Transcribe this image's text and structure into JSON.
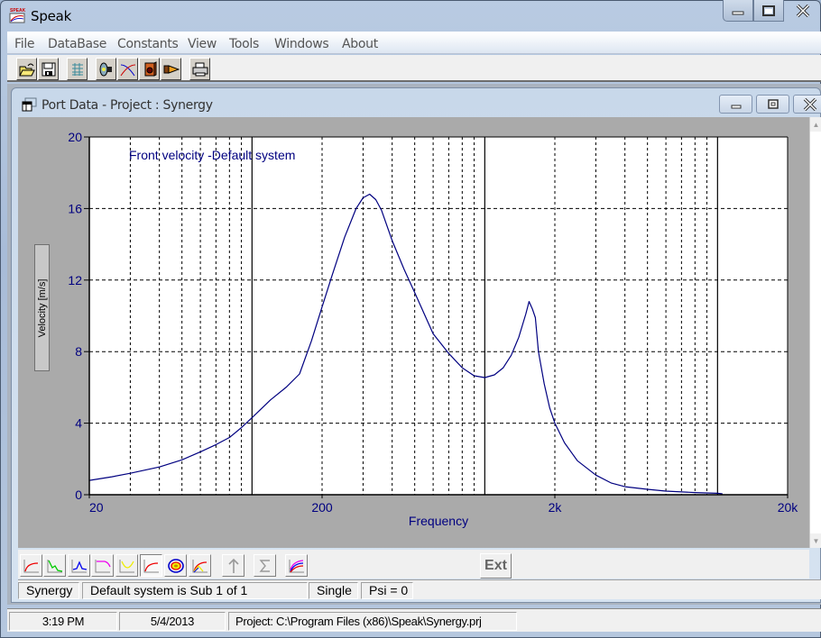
{
  "app": {
    "title": "Speak"
  },
  "menu": [
    "File",
    "DataBase",
    "Constants",
    "View",
    "Tools",
    "Windows",
    "About"
  ],
  "toolbar": {
    "buttons": [
      "open-icon",
      "save-icon",
      "grid-icon",
      "driver-icon",
      "crossover-icon",
      "box-icon",
      "horn-icon",
      "print-icon"
    ]
  },
  "child_window": {
    "title": "Port Data - Project : Synergy"
  },
  "chart_data": {
    "type": "line",
    "title": "Front velocity -Default system",
    "xlabel": "Frequency",
    "ylabel": "Velocity [m/s]",
    "xscale": "log",
    "xlim": [
      20,
      20000
    ],
    "ylim": [
      0,
      20
    ],
    "xticks": [
      20,
      200,
      2000,
      20000
    ],
    "xtick_labels": [
      "20",
      "200",
      "2k",
      "20k"
    ],
    "yticks": [
      0,
      4,
      8,
      12,
      16,
      20
    ],
    "ytick_labels": [
      "0",
      "4",
      "8",
      "12",
      "16",
      "20"
    ],
    "grid": true,
    "series": [
      {
        "name": "Front velocity",
        "color": "#000080",
        "x": [
          20,
          25,
          30,
          40,
          50,
          60,
          70,
          80,
          90,
          100,
          120,
          140,
          160,
          180,
          200,
          220,
          250,
          280,
          300,
          320,
          340,
          360,
          400,
          450,
          500,
          550,
          600,
          700,
          800,
          900,
          1000,
          1100,
          1200,
          1300,
          1400,
          1500,
          1550,
          1600,
          1650,
          1700,
          1800,
          1900,
          2000,
          2200,
          2500,
          3000,
          3500,
          4000,
          5000,
          6000,
          8000,
          10000,
          10500
        ],
        "y": [
          0.8,
          1.0,
          1.2,
          1.55,
          1.95,
          2.4,
          2.8,
          3.2,
          3.75,
          4.3,
          5.3,
          6.0,
          6.75,
          8.6,
          10.5,
          12.2,
          14.4,
          16.0,
          16.6,
          16.8,
          16.5,
          15.9,
          14.2,
          12.6,
          11.3,
          10.1,
          9.0,
          7.9,
          7.1,
          6.65,
          6.55,
          6.7,
          7.1,
          7.8,
          8.8,
          10.1,
          10.8,
          10.4,
          9.9,
          8.0,
          6.2,
          4.85,
          4.0,
          2.9,
          1.9,
          1.1,
          0.65,
          0.45,
          0.3,
          0.2,
          0.12,
          0.08,
          0.05
        ]
      }
    ],
    "major_grid_x": [
      100,
      1000,
      10000
    ],
    "minor_grid_x": [
      30,
      40,
      50,
      60,
      70,
      80,
      90,
      300,
      400,
      500,
      600,
      700,
      800,
      900,
      3000,
      4000,
      5000,
      6000,
      7000,
      8000,
      9000
    ]
  },
  "chart_tools": {
    "buttons": [
      "response-icon",
      "impedance-icon",
      "excursion-icon",
      "phase-icon",
      "delay-icon",
      "velocity-icon",
      "polar-icon",
      "combined-icon",
      "arrow-up-icon",
      "sum-icon",
      "multi-curve-icon"
    ],
    "pressed": "velocity-icon",
    "ext_label": "Ext"
  },
  "child_status": {
    "project": "Synergy",
    "system": "Default system is Sub 1 of 1",
    "mode": "Single",
    "psi": "Psi = 0"
  },
  "status_bar": {
    "time": "3:19 PM",
    "date": "5/4/2013",
    "project_path": "Project: C:\\Program Files (x86)\\Speak\\Synergy.prj"
  }
}
